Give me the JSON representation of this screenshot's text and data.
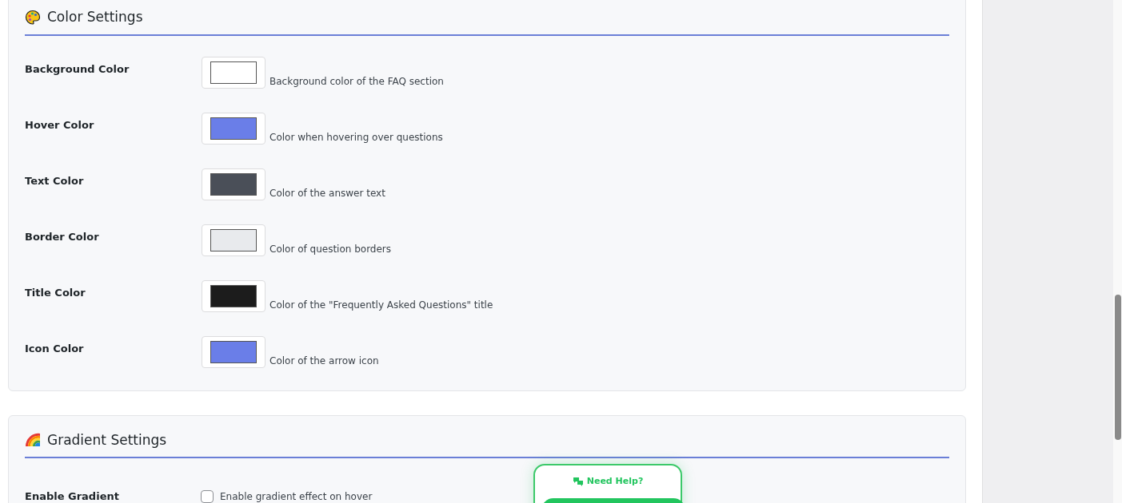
{
  "color_settings": {
    "title": "Color Settings",
    "rows": [
      {
        "label": "Background Color",
        "color": "#ffffff",
        "description": "Background color of the FAQ section"
      },
      {
        "label": "Hover Color",
        "color": "#6a7ee8",
        "description": "Color when hovering over questions"
      },
      {
        "label": "Text Color",
        "color": "#4a4f58",
        "description": "Color of the answer text"
      },
      {
        "label": "Border Color",
        "color": "#e8eaed",
        "description": "Color of question borders"
      },
      {
        "label": "Title Color",
        "color": "#1c1c1c",
        "description": "Color of the \"Frequently Asked Questions\" title"
      },
      {
        "label": "Icon Color",
        "color": "#6a7ee8",
        "description": "Color of the arrow icon"
      }
    ]
  },
  "gradient_settings": {
    "title": "Gradient Settings",
    "rows": [
      {
        "label": "Enable Gradient",
        "checked": false,
        "description": "Enable gradient effect on hover"
      }
    ]
  },
  "help_widget": {
    "title": "Need Help?"
  }
}
